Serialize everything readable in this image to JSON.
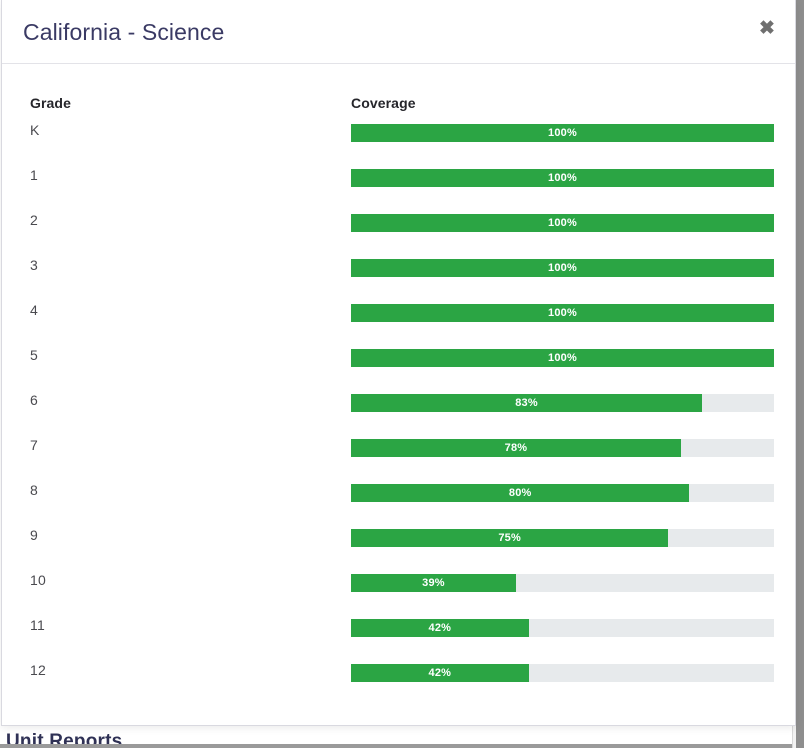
{
  "background_page": {
    "heading": "Unit Reports"
  },
  "modal": {
    "title": "California - Science",
    "close_label": "✖",
    "close_icon": "close-icon",
    "columns": {
      "grade": "Grade",
      "coverage": "Coverage"
    },
    "colors": {
      "bar_fill": "#2ba544",
      "bar_track": "#e7eaec",
      "title_text": "#3a3a64",
      "header_text": "#26262b",
      "row_text": "#4a4a4f",
      "bar_label_text": "#ffffff"
    },
    "rows": [
      {
        "grade": "K",
        "coverage_label": "100%",
        "coverage_value": 100
      },
      {
        "grade": "1",
        "coverage_label": "100%",
        "coverage_value": 100
      },
      {
        "grade": "2",
        "coverage_label": "100%",
        "coverage_value": 100
      },
      {
        "grade": "3",
        "coverage_label": "100%",
        "coverage_value": 100
      },
      {
        "grade": "4",
        "coverage_label": "100%",
        "coverage_value": 100
      },
      {
        "grade": "5",
        "coverage_label": "100%",
        "coverage_value": 100
      },
      {
        "grade": "6",
        "coverage_label": "83%",
        "coverage_value": 83
      },
      {
        "grade": "7",
        "coverage_label": "78%",
        "coverage_value": 78
      },
      {
        "grade": "8",
        "coverage_label": "80%",
        "coverage_value": 80
      },
      {
        "grade": "9",
        "coverage_label": "75%",
        "coverage_value": 75
      },
      {
        "grade": "10",
        "coverage_label": "39%",
        "coverage_value": 39
      },
      {
        "grade": "11",
        "coverage_label": "42%",
        "coverage_value": 42
      },
      {
        "grade": "12",
        "coverage_label": "42%",
        "coverage_value": 42
      }
    ]
  },
  "chart_data": {
    "type": "bar",
    "title": "California - Science",
    "xlabel": "Coverage",
    "ylabel": "Grade",
    "categories": [
      "K",
      "1",
      "2",
      "3",
      "4",
      "5",
      "6",
      "7",
      "8",
      "9",
      "10",
      "11",
      "12"
    ],
    "values": [
      100,
      100,
      100,
      100,
      100,
      100,
      83,
      78,
      80,
      75,
      39,
      42,
      42
    ],
    "value_labels": [
      "100%",
      "100%",
      "100%",
      "100%",
      "100%",
      "100%",
      "83%",
      "78%",
      "80%",
      "75%",
      "39%",
      "42%",
      "42%"
    ],
    "xlim": [
      0,
      100
    ],
    "unit": "%",
    "orientation": "horizontal",
    "grid": false,
    "legend": false
  }
}
